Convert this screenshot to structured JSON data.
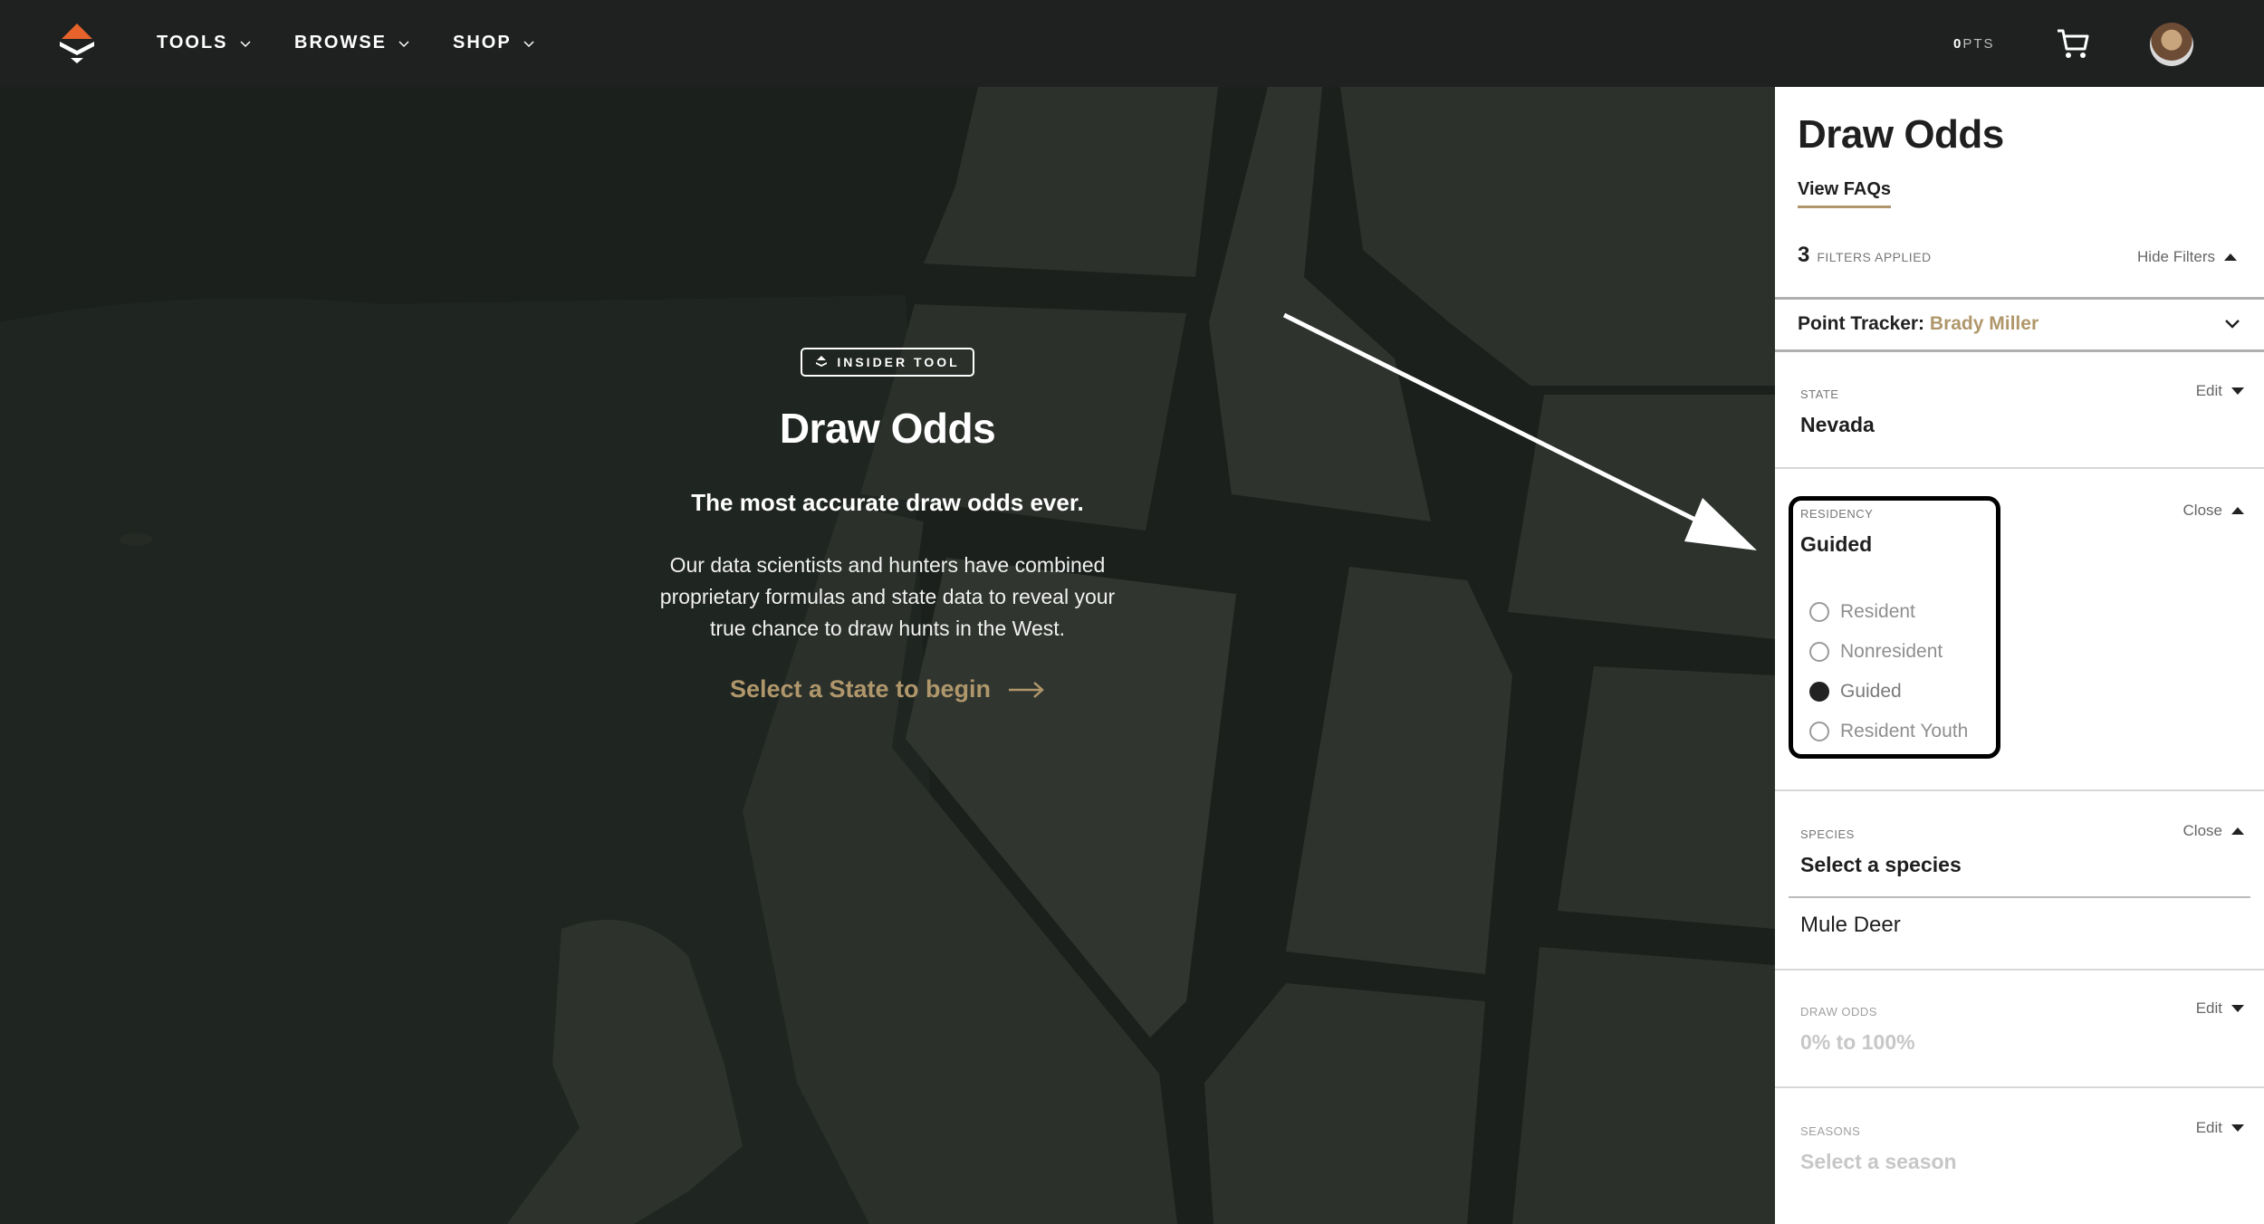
{
  "nav": {
    "items": [
      {
        "label": "TOOLS"
      },
      {
        "label": "BROWSE"
      },
      {
        "label": "SHOP"
      }
    ],
    "points_prefix": "0",
    "points_suffix": "PTS",
    "brand_color": "#e8632b"
  },
  "hero": {
    "badge": "INSIDER TOOL",
    "title": "Draw Odds",
    "tagline": "The most accurate draw odds ever.",
    "description": "Our data scientists and hunters have combined proprietary formulas and state data to reveal your true chance to draw hunts in the West.",
    "cta": "Select a State to begin",
    "cta_color": "#b0976b"
  },
  "panel": {
    "title": "Draw Odds",
    "faq_link": "View FAQs",
    "filters_count": "3",
    "filters_label": "FILTERS APPLIED",
    "hide_filters": "Hide Filters",
    "tracker_label": "Point Tracker:",
    "tracker_name": "Brady Miller",
    "state": {
      "label": "STATE",
      "value": "Nevada",
      "action": "Edit"
    },
    "residency": {
      "label": "RESIDENCY",
      "value": "Guided",
      "action": "Close",
      "options": [
        {
          "label": "Resident",
          "selected": false
        },
        {
          "label": "Nonresident",
          "selected": false
        },
        {
          "label": "Guided",
          "selected": true
        },
        {
          "label": "Resident Youth",
          "selected": false
        }
      ]
    },
    "species": {
      "label": "SPECIES",
      "value": "Select a species",
      "action": "Close",
      "option": "Mule Deer"
    },
    "draw_odds": {
      "label": "DRAW ODDS",
      "value": "0% to 100%",
      "action": "Edit"
    },
    "seasons": {
      "label": "SEASONS",
      "value": "Select a season",
      "action": "Edit"
    }
  }
}
